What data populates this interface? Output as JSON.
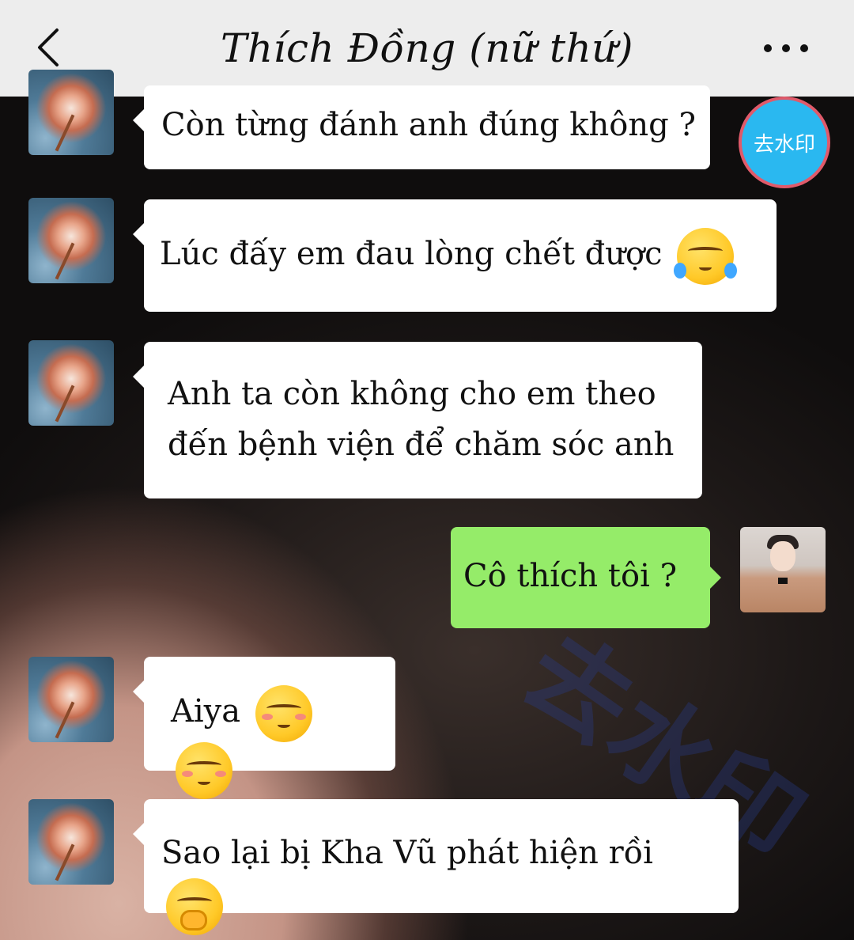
{
  "header": {
    "title": "Thích Đồng (nữ thứ)"
  },
  "watermark_badge": {
    "label": "去水印"
  },
  "background_watermark": {
    "text": "去水印"
  },
  "messages": [
    {
      "side": "left",
      "text": "Còn từng đánh anh đúng không ?"
    },
    {
      "side": "left",
      "text": "Lúc đấy em đau lòng chết được",
      "emoji": "crying-laughing-emoji"
    },
    {
      "side": "left",
      "lines": [
        "Anh ta còn không cho em theo",
        "đến bệnh viện để chăm sóc anh"
      ]
    },
    {
      "side": "right",
      "text": "Cô thích tôi ?"
    },
    {
      "side": "left",
      "text": "Aiya",
      "emoji": "blushing-emoji"
    },
    {
      "side": "left",
      "text": "Sao lại bị Kha Vũ phát hiện rồi",
      "emoji": "hand-over-mouth-emoji"
    }
  ],
  "colors": {
    "header_bg": "#ededed",
    "incoming_bubble": "#ffffff",
    "outgoing_bubble": "#95ec69",
    "badge_bg": "#2ab8f0",
    "badge_border": "#e05a6a"
  }
}
